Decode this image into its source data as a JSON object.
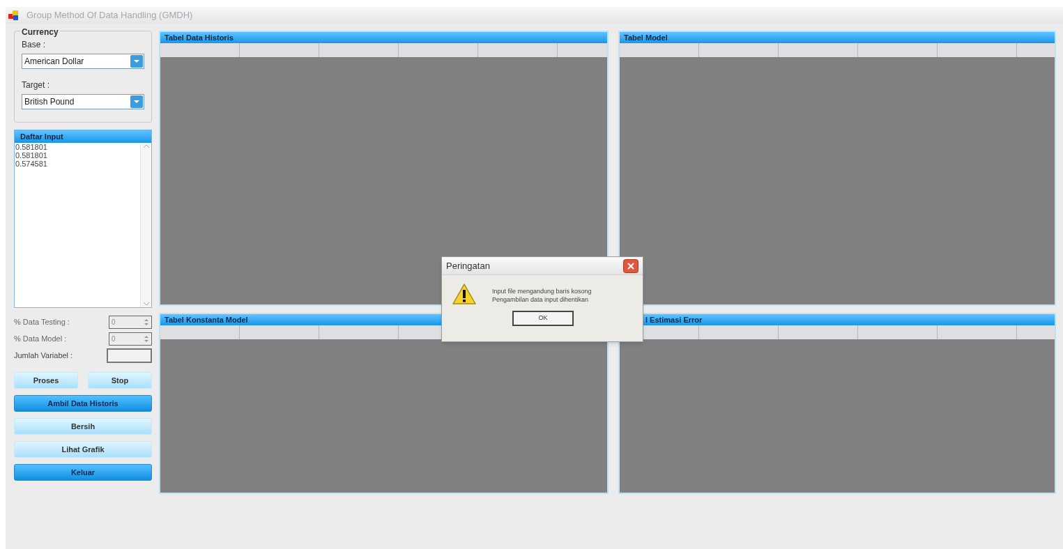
{
  "window": {
    "title": "Group Method Of Data Handling (GMDH)"
  },
  "currency": {
    "title": "Currency",
    "fields": [
      {
        "label": "Base :",
        "value": "American Dollar"
      },
      {
        "label": "Target :",
        "value": "British Pound"
      }
    ]
  },
  "input_list": {
    "title": "Daftar Input",
    "items": [
      "0.581801",
      "0.581801",
      "0.574581"
    ]
  },
  "settings": [
    {
      "kind": "spinner",
      "label": "% Data Testing :",
      "value": "0",
      "disabled": true
    },
    {
      "kind": "spinner",
      "label": "% Data Model :",
      "value": "0",
      "disabled": true
    },
    {
      "kind": "textbox",
      "label": "Jumlah Variabel :",
      "disabled": false
    }
  ],
  "button_row": [
    {
      "label": "Proses",
      "kind": "light"
    },
    {
      "label": "Stop",
      "kind": "light"
    }
  ],
  "buttons": [
    {
      "label": "Ambil Data Historis",
      "kind": "dark"
    },
    {
      "label": "Bersih",
      "kind": "light"
    },
    {
      "label": "Lihat Grafik",
      "kind": "light"
    },
    {
      "label": "Keluar",
      "kind": "dark"
    }
  ],
  "panels": [
    {
      "title": "Tabel Data Historis"
    },
    {
      "title": "Tabel Model"
    },
    {
      "title": "Tabel Konstanta Model"
    },
    {
      "title": "l Estimasi Error",
      "covered": true
    }
  ],
  "dialog": {
    "title": "Peringatan",
    "message": [
      "Input file mengandung baris kosong",
      "Pengambilan data input dihentikan"
    ],
    "button": "OK"
  }
}
